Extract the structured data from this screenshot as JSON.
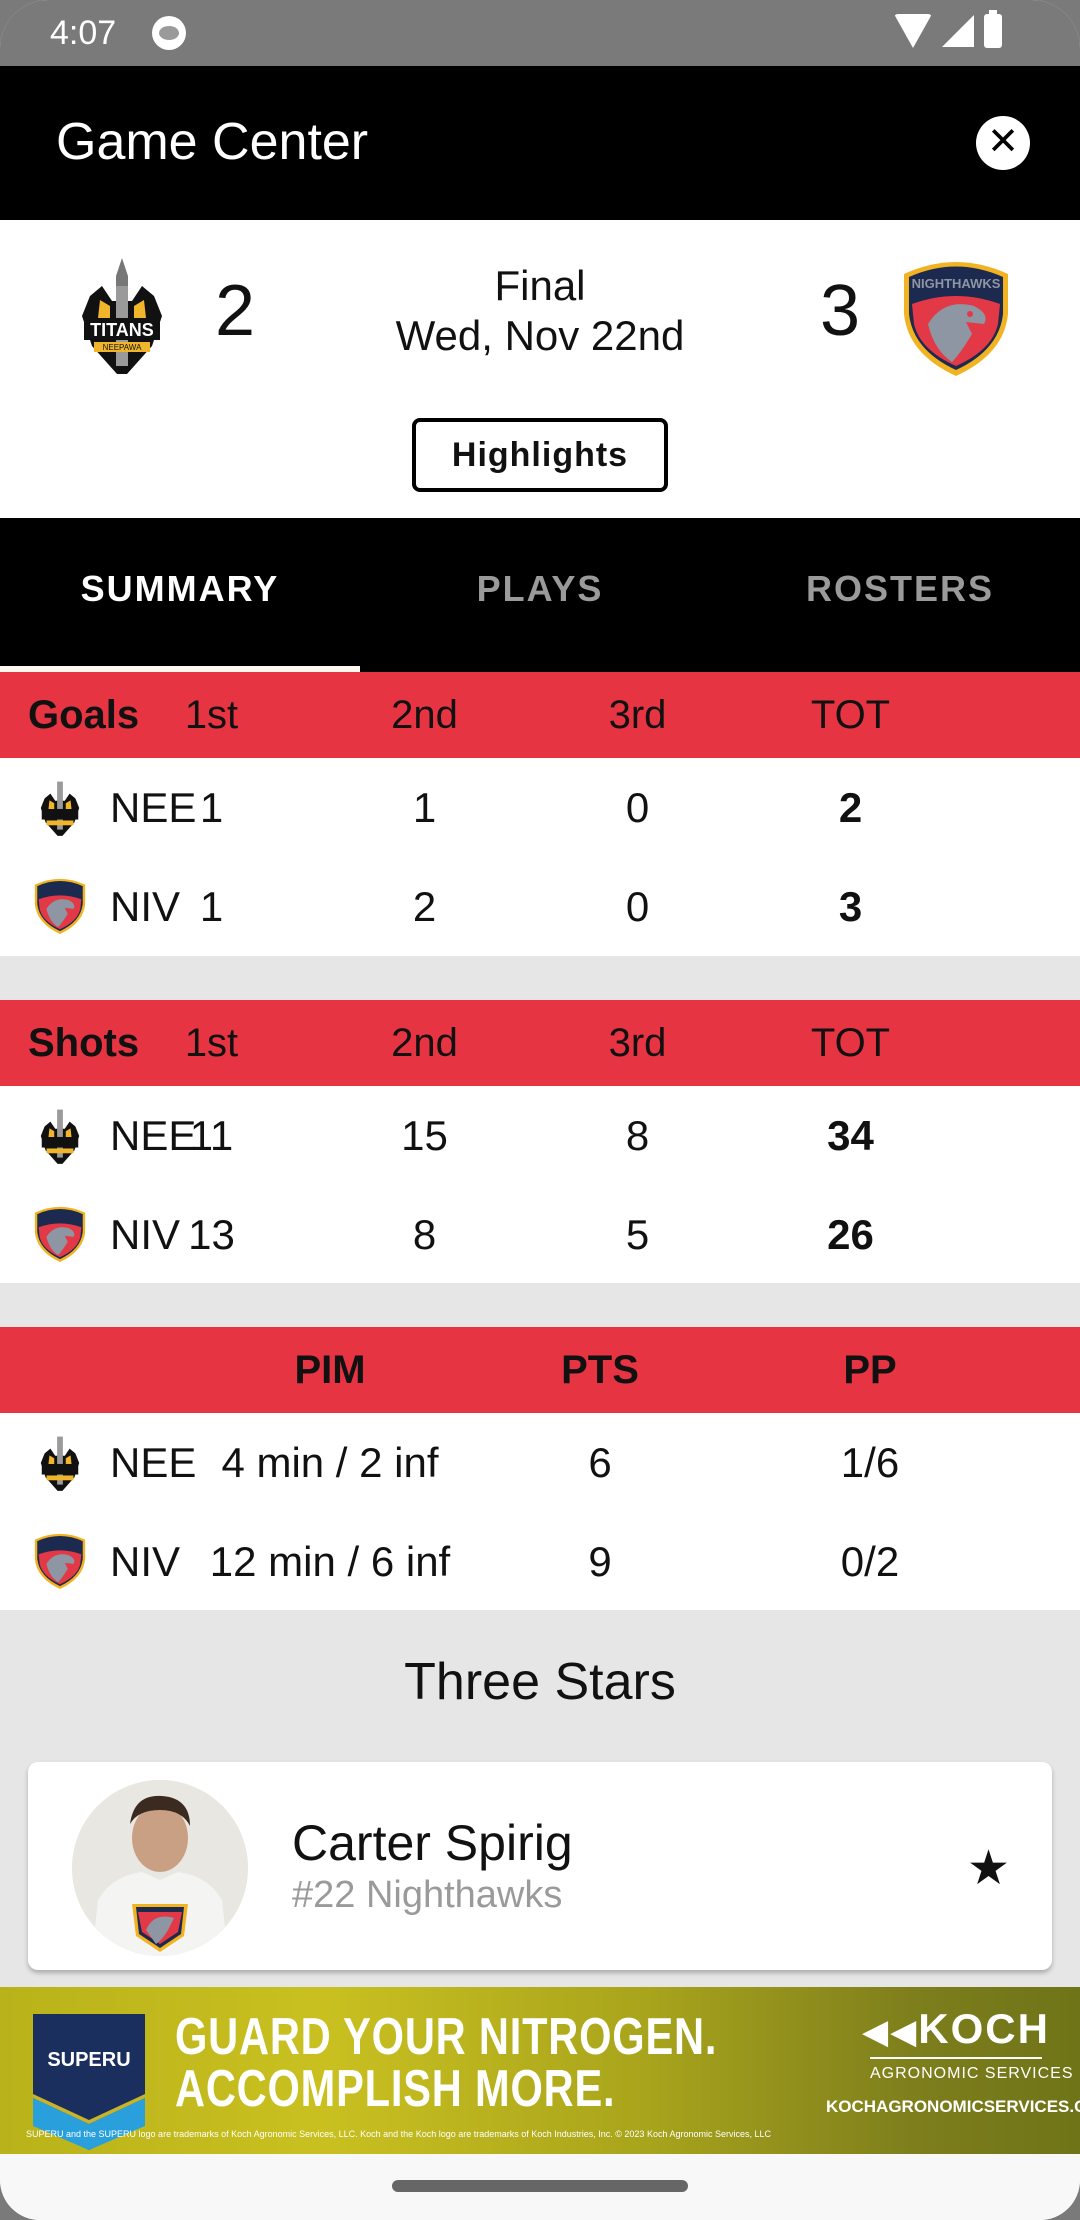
{
  "status_bar": {
    "time": "4:07"
  },
  "app_bar": {
    "title": "Game Center",
    "close_icon": "close-icon"
  },
  "game": {
    "home": {
      "name": "Titans",
      "abbr": "NEE",
      "score": "2",
      "logo": "titans-logo"
    },
    "away": {
      "name": "Nighthawks",
      "abbr": "NIV",
      "score": "3",
      "logo": "nighthawks-logo"
    },
    "status": "Final",
    "date": "Wed, Nov 22nd",
    "highlights_label": "Highlights"
  },
  "tabs": [
    {
      "label": "SUMMARY",
      "active": true
    },
    {
      "label": "PLAYS",
      "active": false
    },
    {
      "label": "ROSTERS",
      "active": false
    }
  ],
  "goals_table": {
    "headers": [
      "Goals",
      "1st",
      "2nd",
      "3rd",
      "TOT"
    ],
    "rows": [
      {
        "team": "NEE",
        "values": [
          "1",
          "1",
          "0",
          "2"
        ]
      },
      {
        "team": "NIV",
        "values": [
          "1",
          "2",
          "0",
          "3"
        ]
      }
    ]
  },
  "shots_table": {
    "headers": [
      "Shots",
      "1st",
      "2nd",
      "3rd",
      "TOT"
    ],
    "rows": [
      {
        "team": "NEE",
        "values": [
          "11",
          "15",
          "8",
          "34"
        ]
      },
      {
        "team": "NIV",
        "values": [
          "13",
          "8",
          "5",
          "26"
        ]
      }
    ]
  },
  "misc_table": {
    "headers": [
      "",
      "PIM",
      "PTS",
      "PP"
    ],
    "rows": [
      {
        "team": "NEE",
        "values": [
          "4 min / 2 inf",
          "6",
          "1/6"
        ]
      },
      {
        "team": "NIV",
        "values": [
          "12 min / 6 inf",
          "9",
          "0/2"
        ]
      }
    ]
  },
  "three_stars": {
    "title": "Three Stars",
    "players": [
      {
        "name": "Carter Spirig",
        "detail": "#22 Nighthawks",
        "stars": 1
      }
    ]
  },
  "ad": {
    "brand_badge": "SUPERU",
    "headline_1": "GUARD YOUR NITROGEN.",
    "headline_2": "ACCOMPLISH MORE.",
    "sponsor": "KOCH",
    "sponsor_sub": "AGRONOMIC SERVICES",
    "url": "KOCHAGRONOMICSERVICES.CA",
    "fine_print": "SUPERU and the SUPERU logo are trademarks of Koch Agronomic Services, LLC. Koch and the Koch logo are trademarks of Koch Industries, Inc. © 2023 Koch Agronomic Services, LLC"
  },
  "colors": {
    "accent_red": "#e73442",
    "header_black": "#000000",
    "gap_gray": "#e6e6e6"
  }
}
